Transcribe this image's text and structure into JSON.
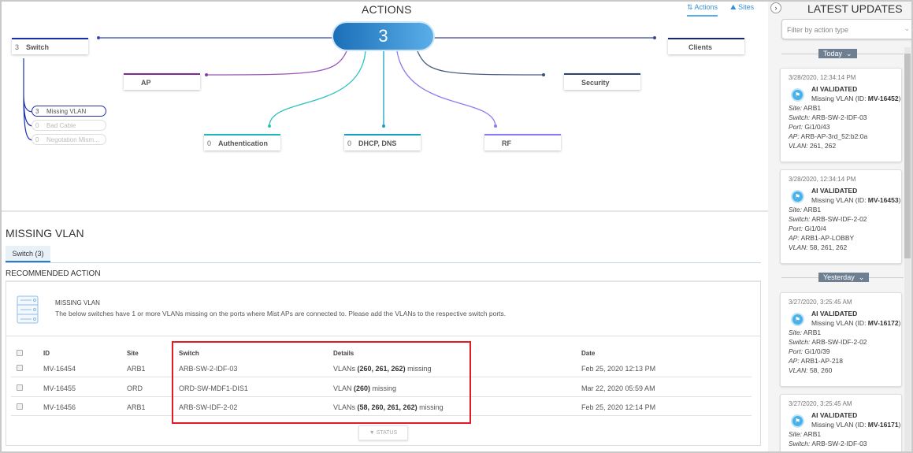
{
  "actions": {
    "title": "ACTIONS",
    "total": "3",
    "view_tabs": [
      {
        "label": "Actions",
        "icon": "actions-icon",
        "active": true
      },
      {
        "label": "Sites",
        "icon": "sites-icon"
      }
    ],
    "nodes": {
      "switch": {
        "count": "3",
        "label": "Switch",
        "color": "#1a2faa"
      },
      "clients": {
        "count": "",
        "label": "Clients",
        "color": "#1b2a6b"
      },
      "ap": {
        "count": "",
        "label": "AP",
        "color": "#7a2d8f"
      },
      "security": {
        "count": "",
        "label": "Security",
        "color": "#2d4468"
      },
      "authentication": {
        "count": "0",
        "label": "Authentication",
        "color": "#1fb8b8"
      },
      "dhcp": {
        "count": "0",
        "label": "DHCP, DNS",
        "color": "#19a0bf"
      },
      "rf": {
        "count": "",
        "label": "RF",
        "color": "#8a7cf5"
      }
    },
    "switch_subitems": [
      {
        "count": "3",
        "label": "Missing VLAN",
        "active": true
      },
      {
        "count": "0",
        "label": "Bad Cable"
      },
      {
        "count": "0",
        "label": "Negotation Mism..."
      }
    ]
  },
  "detail": {
    "title": "MISSING VLAN",
    "tab": "Switch (3)",
    "recommended_label": "RECOMMENDED ACTION",
    "info_title": "MISSING VLAN",
    "info_text": "The below switches have 1 or more VLANs missing on the ports where Mist APs are connected to. Please add the VLANs to the respective switch ports.",
    "columns": [
      "ID",
      "Site",
      "Switch",
      "Details",
      "Date"
    ],
    "rows": [
      {
        "id": "MV-16454",
        "site": "ARB1",
        "switch": "ARB-SW-2-IDF-03",
        "pre": "VLANs ",
        "vlans": "(260, 261, 262)",
        "post": " missing",
        "date": "Feb 25, 2020 12:13 PM"
      },
      {
        "id": "MV-16455",
        "site": "ORD",
        "switch": "ORD-SW-MDF1-DIS1",
        "pre": "VLAN ",
        "vlans": "(260)",
        "post": " missing",
        "date": "Mar 22, 2020 05:59 AM"
      },
      {
        "id": "MV-16456",
        "site": "ARB1",
        "switch": "ARB-SW-IDF-2-02",
        "pre": "VLANs ",
        "vlans": "(58, 260, 261, 262)",
        "post": " missing",
        "date": "Feb 25, 2020 12:14 PM"
      }
    ],
    "status_button": "STATUS"
  },
  "updates": {
    "title": "LATEST UPDATES",
    "filter_placeholder": "Filter by action type",
    "groups": [
      "Today",
      "Yesterday"
    ],
    "cards": [
      {
        "ts": "3/28/2020, 12:34:14 PM",
        "status": "AI VALIDATED",
        "text": "Missing VLAN (ID: ",
        "id": "MV-16452",
        "site": "ARB1",
        "switch": "ARB-SW-2-IDF-03",
        "port": "Gi1/0/43",
        "ap": "ARB-AP-3rd_52:b2:0a",
        "vlan": "261, 262"
      },
      {
        "ts": "3/28/2020, 12:34:14 PM",
        "status": "AI VALIDATED",
        "text": "Missing VLAN (ID: ",
        "id": "MV-16453",
        "site": "ARB1",
        "switch": "ARB-SW-IDF-2-02",
        "port": "Gi1/0/4",
        "ap": "ARB1-AP-LOBBY",
        "vlan": "58, 261, 262"
      },
      {
        "ts": "3/27/2020, 3:25:45 AM",
        "status": "AI VALIDATED",
        "text": "Missing VLAN (ID: ",
        "id": "MV-16172",
        "site": "ARB1",
        "switch": "ARB-SW-IDF-2-02",
        "port": "Gi1/0/39",
        "ap": "ARB1-AP-218",
        "vlan": "58, 260"
      },
      {
        "ts": "3/27/2020, 3:25:45 AM",
        "status": "AI VALIDATED",
        "text": "Missing VLAN (ID: ",
        "id": "MV-16171",
        "site": "ARB1",
        "switch": "ARB-SW-2-IDF-03",
        "port": "",
        "ap": "",
        "vlan": ""
      }
    ],
    "field_labels": {
      "site": "Site:",
      "switch": "Switch:",
      "port": "Port:",
      "ap": "AP:",
      "vlan": "VLAN:"
    }
  }
}
